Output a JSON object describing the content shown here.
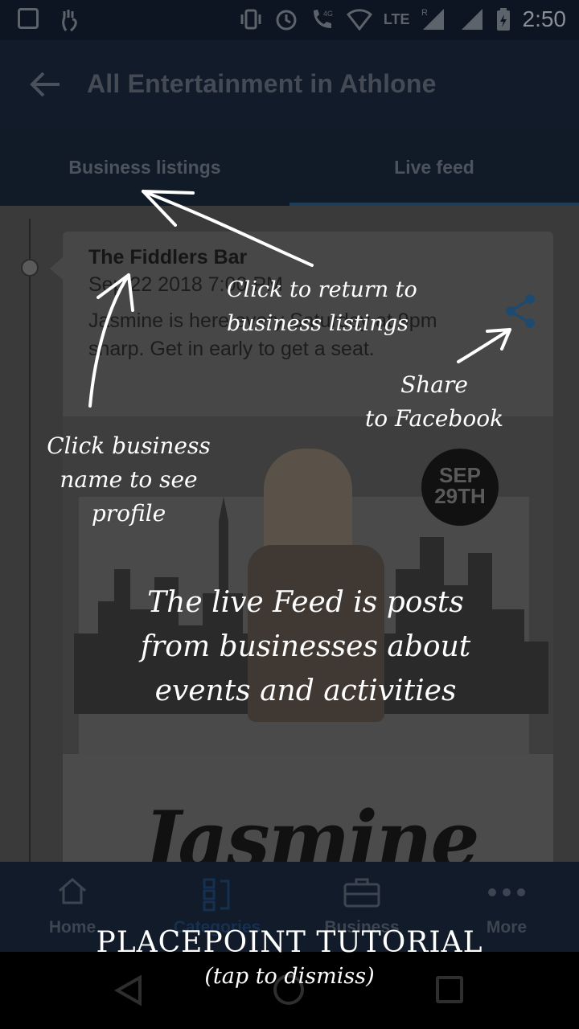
{
  "status_bar": {
    "time": "2:50",
    "network": "LTE",
    "signal_label": "4G",
    "roaming": "R"
  },
  "app_bar": {
    "title": "All Entertainment in Athlone"
  },
  "tabs": [
    {
      "label": "Business listings"
    },
    {
      "label": "Live feed"
    }
  ],
  "card": {
    "business_name": "The Fiddlers Bar",
    "date": "Sep 22 2018 7:00 PM",
    "text": "Jasmine is here every Saturday at 9pm sharp. Get in early to get a seat.",
    "poster": {
      "badge_month": "SEP",
      "badge_day": "29TH",
      "script": "Jasmine"
    }
  },
  "bottom_nav": [
    {
      "label": "Home",
      "icon": "home-icon"
    },
    {
      "label": "Categories",
      "icon": "categories-icon"
    },
    {
      "label": "Business",
      "icon": "briefcase-icon"
    },
    {
      "label": "More",
      "icon": "more-icon"
    }
  ],
  "tutorial": {
    "return_hint": [
      "Click to return to",
      "business listings"
    ],
    "share_hint": [
      "Share",
      "to Facebook"
    ],
    "profile_hint": [
      "Click business",
      "name to see",
      "profile"
    ],
    "live_hint": [
      "The live Feed is posts",
      "from businesses about",
      "events and activities"
    ],
    "title": "PLACEPOINT TUTORIAL",
    "subtitle": "(tap to dismiss)"
  },
  "colors": {
    "overlay_text": "#ffffff",
    "accent": "#1e3d58",
    "appbar": "#121b2a"
  }
}
